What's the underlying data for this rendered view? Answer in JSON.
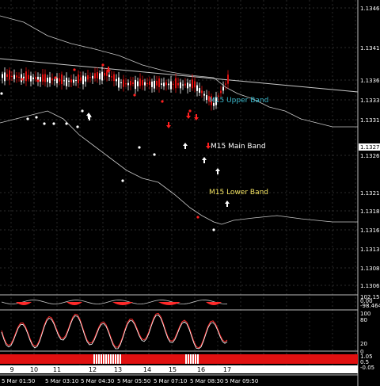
{
  "price_axis": {
    "labels": [
      "1.13460",
      "1.13410",
      "1.13360",
      "1.13335",
      "1.13310",
      "1.13260",
      "1.13210",
      "1.13185",
      "1.13160",
      "1.13135",
      "1.13085",
      "1.13060"
    ],
    "current_price": "1.13275"
  },
  "band_labels": {
    "upper": {
      "text": "M15 Upper Band",
      "color": "#38b6c9"
    },
    "main": {
      "text": "M15 Main Band",
      "color": "#ffffff"
    },
    "lower": {
      "text": "M15 Lower Band",
      "color": "#f0e060"
    }
  },
  "indicator1_axis": [
    "102.153",
    "0.00",
    "-98.464"
  ],
  "indicator2_axis": [
    "100",
    "80",
    "20",
    "0"
  ],
  "indicator3_axis": [
    "1.05",
    "0.5",
    "-0.05"
  ],
  "counter_labels": [
    "9",
    "10",
    "11",
    "12",
    "13",
    "14",
    "15",
    "16",
    "17"
  ],
  "time_axis": [
    "5 Mar 01:50",
    "5 Mar 03:10",
    "5 Mar 04:30",
    "5 Mar 05:50",
    "5 Mar 07:10",
    "5 Mar 08:30",
    "5 Mar 09:50"
  ],
  "colors": {
    "bull": "#ffffff",
    "bear": "#e01010",
    "arrow_up": "#ffffff",
    "arrow_down": "#ff2020",
    "band": "#c8c8c8",
    "grid": "#3a3a3a",
    "oscillator": "#ff2a2a"
  }
}
